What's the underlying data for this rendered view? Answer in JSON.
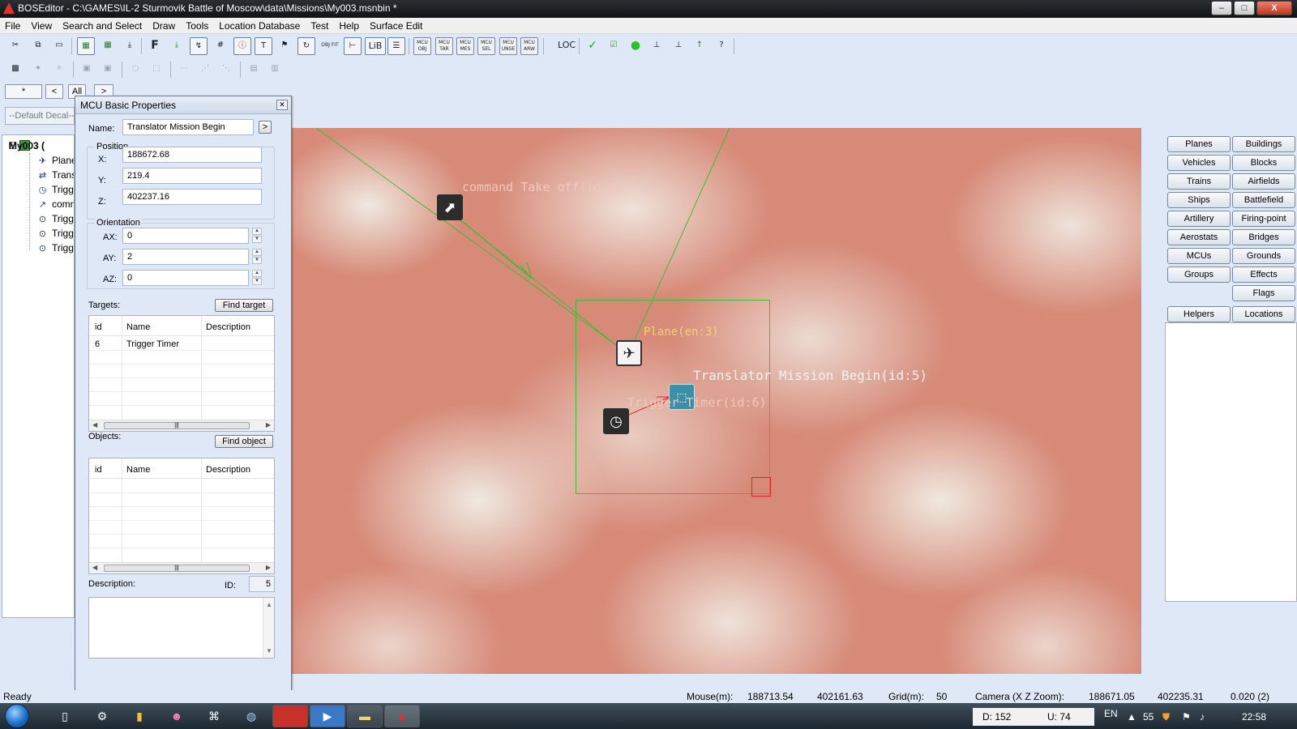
{
  "window": {
    "title": "BOSEditor - C:\\GAMES\\IL-2 Sturmovik Battle of Moscow\\data\\Missions\\My003.msnbin *",
    "minimize": "–",
    "maximize": "□",
    "close": "X"
  },
  "menu": [
    "File",
    "View",
    "Search and Select",
    "Draw",
    "Tools",
    "Location Database",
    "Test",
    "Help",
    "Surface Edit"
  ],
  "toolbar1": {
    "f_label": "F",
    "mcu_labels": [
      "MCU OBJ",
      "MCU TAR",
      "MCU MES",
      "MCU SEL",
      "MCU UNSE",
      "MCU ARW"
    ],
    "lib_label": "LiB",
    "loc_label": "LOC"
  },
  "toolbar3": {
    "star": "*",
    "prev": "<",
    "all": "All",
    "next": ">"
  },
  "decal": {
    "value": "--Default Decal--"
  },
  "tree": {
    "root": "My003 (",
    "items": [
      {
        "icon": "plane-icon",
        "label": "Plane"
      },
      {
        "icon": "translator-icon",
        "label": "Trans"
      },
      {
        "icon": "timer-icon",
        "label": "Trigg"
      },
      {
        "icon": "command-icon",
        "label": "comm"
      },
      {
        "icon": "trigger-icon",
        "label": "Trigg"
      },
      {
        "icon": "trigger-icon",
        "label": "Trigg"
      },
      {
        "icon": "trigger-icon",
        "label": "Trigg"
      }
    ]
  },
  "mcu": {
    "title": "MCU Basic Properties",
    "name_label": "Name:",
    "name_value": "Translator Mission Begin",
    "name_btn": ">",
    "position_label": "Position",
    "x_label": "X:",
    "x_value": "188672.68",
    "y_label": "Y:",
    "y_value": "219.4",
    "z_label": "Z:",
    "z_value": "402237.16",
    "orientation_label": "Orientation",
    "ax_label": "AX:",
    "ax_value": "0",
    "ay_label": "AY:",
    "ay_value": "2",
    "az_label": "AZ:",
    "az_value": "0",
    "targets_label": "Targets:",
    "find_target": "Find target",
    "objects_label": "Objects:",
    "find_object": "Find object",
    "columns": [
      "id",
      "Name",
      "Description"
    ],
    "targets": [
      {
        "id": "6",
        "name": "Trigger Timer",
        "description": ""
      }
    ],
    "description_label": "Description:",
    "id_label": "ID:",
    "id_value": "5"
  },
  "map": {
    "labels": {
      "command": "command Take off(id:8)",
      "plane": "Plane(en:3)",
      "translator": "Translator Mission Begin(id:5)",
      "trigger": "Trigger Timer(id:6)"
    },
    "colors": {
      "link_green": "#3cbc3c",
      "link_red": "#d8262b",
      "plane_label": "#e8d86a",
      "translator_label": "#f4f2ee",
      "faded_label": "#f0c8bc"
    }
  },
  "right_buttons": [
    [
      "Planes",
      "Buildings"
    ],
    [
      "Vehicles",
      "Blocks"
    ],
    [
      "Trains",
      "Airfields"
    ],
    [
      "Ships",
      "Battlefield"
    ],
    [
      "Artillery",
      "Firing-point"
    ],
    [
      "Aerostats",
      "Bridges"
    ],
    [
      "MCUs",
      "Grounds"
    ],
    [
      "Groups",
      "Effects"
    ],
    [
      "",
      "Flags"
    ],
    [
      "Helpers",
      "Locations"
    ]
  ],
  "status": {
    "ready": "Ready",
    "mouse_label": "Mouse(m):",
    "mouse_x": "188713.54",
    "mouse_z": "402161.63",
    "grid_label": "Grid(m):",
    "grid_value": "50",
    "camera_label": "Camera (X  Z  Zoom):",
    "camera_x": "188671.05",
    "camera_z": "402235.31",
    "camera_zoom": "0.020 (2)"
  },
  "taskbar": {
    "d_value": "D: 152",
    "u_value": "U: 74",
    "lang": "EN",
    "tray_num": "55",
    "clock": "22:58"
  }
}
